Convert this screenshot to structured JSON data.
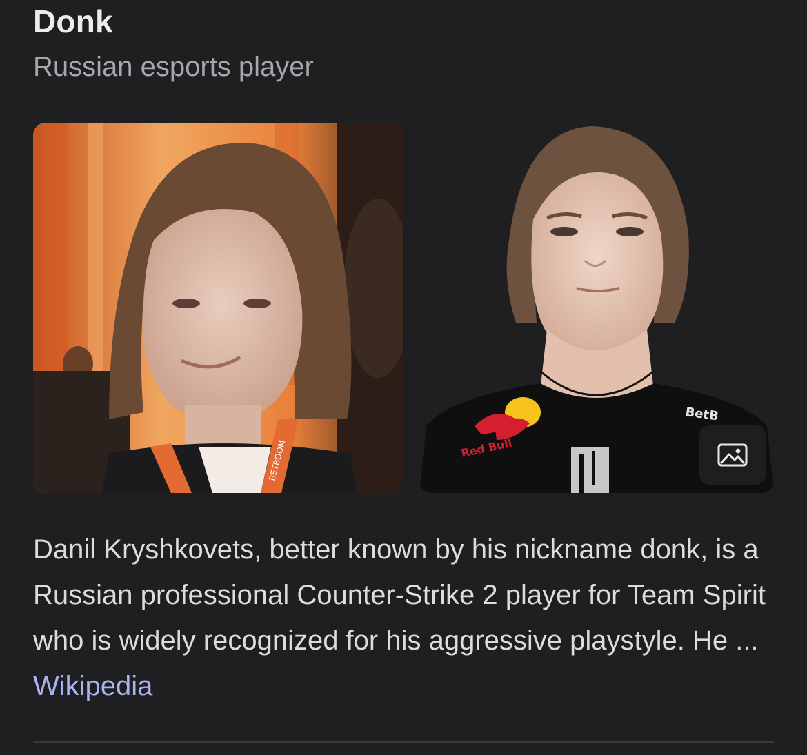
{
  "entity": {
    "title": "Donk",
    "subtitle": "Russian esports player"
  },
  "images": {
    "left_alt": "Photo of Donk",
    "right_alt": "Portrait of Donk",
    "right_jersey_text": "BetB",
    "right_sponsor_text": "Red Bull",
    "left_lanyard_text": "BETBOOM",
    "gallery_icon": "image-gallery-icon"
  },
  "description": {
    "text": "Danil Kryshkovets, better known by his nickname donk, is a Russian professional Counter-Strike 2 player for Team Spirit who is widely recognized for his aggressive playstyle. He ... ",
    "source_link": "Wikipedia"
  },
  "colors": {
    "background": "#1f1f21",
    "link": "#aab3ef",
    "subtitle": "#a6a6ab"
  }
}
